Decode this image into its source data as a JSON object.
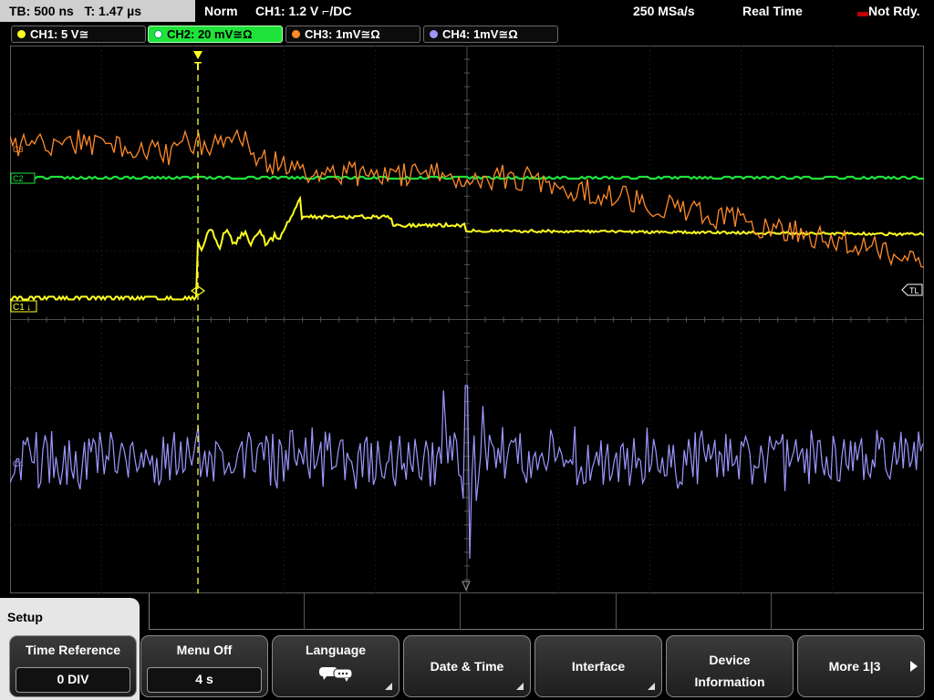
{
  "topbar": {
    "timebase": "TB: 500 ns",
    "trigger_time": "T: 1.47 µs",
    "mode": "Norm",
    "trigger_source": "CH1: 1.2 V ⌐/DC",
    "sample_rate": "250 MSa/s",
    "acq_mode": "Real Time",
    "status": "Not Rdy."
  },
  "channels": [
    {
      "label": "CH1: 5 V≅",
      "color": "#ffff22"
    },
    {
      "label": "CH2: 20 mV≅Ω",
      "color": "#1fe33a"
    },
    {
      "label": "CH3: 1mV≅Ω",
      "color": "#ff8a2a"
    },
    {
      "label": "CH4: 1mV≅Ω",
      "color": "#9d97ff"
    }
  ],
  "markers": {
    "trigger": "T",
    "ch1": "C1",
    "ch2": "C2",
    "ch3": "C3",
    "ch4": "C4",
    "trigger_level": "TL"
  },
  "menu": {
    "title": "Setup",
    "time_reference": {
      "label": "Time Reference",
      "value": "0 DIV"
    },
    "menu_off": {
      "label": "Menu Off",
      "value": "4 s"
    },
    "language": {
      "label": "Language"
    },
    "date_time": {
      "label": "Date & Time"
    },
    "interface": {
      "label": "Interface"
    },
    "device_information": {
      "line1": "Device",
      "line2": "Information"
    },
    "more": {
      "label": "More 1|3"
    }
  },
  "icons": {
    "language": "speech-bubbles-icon",
    "more": "right-arrow-icon",
    "submenu": "submenu-corner-icon"
  }
}
